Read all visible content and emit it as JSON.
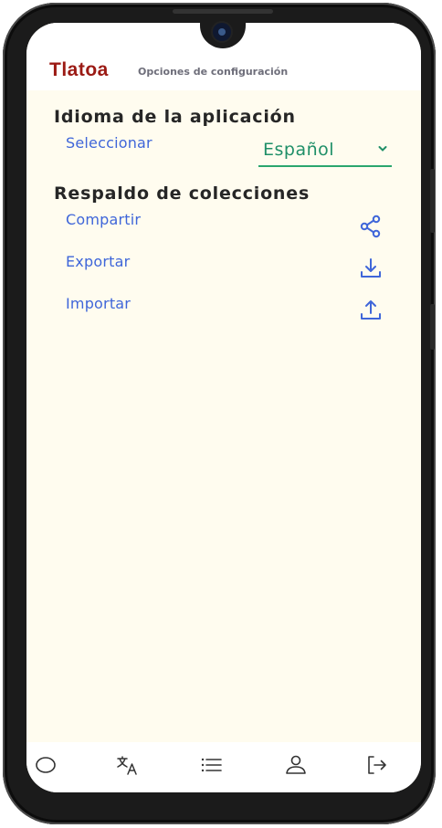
{
  "header": {
    "app_title": "Tlatoa",
    "page_title": "Opciones de configuración"
  },
  "language": {
    "section_title": "Idioma de la aplicación",
    "select_label": "Seleccionar",
    "selected_value": "Español"
  },
  "backup": {
    "section_title": "Respaldo de colecciones",
    "actions": [
      {
        "label": "Compartir",
        "icon": "share-icon"
      },
      {
        "label": "Exportar",
        "icon": "download-icon"
      },
      {
        "label": "Importar",
        "icon": "upload-icon"
      }
    ]
  },
  "bottom_nav": {
    "items": [
      {
        "icon": "circle-icon"
      },
      {
        "icon": "translate-icon"
      },
      {
        "icon": "list-icon"
      },
      {
        "icon": "user-icon"
      },
      {
        "icon": "logout-icon"
      }
    ]
  },
  "colors": {
    "brand": "#9b1a14",
    "link": "#3f66d9",
    "accent": "#1f8f68",
    "background": "#fffcef"
  }
}
